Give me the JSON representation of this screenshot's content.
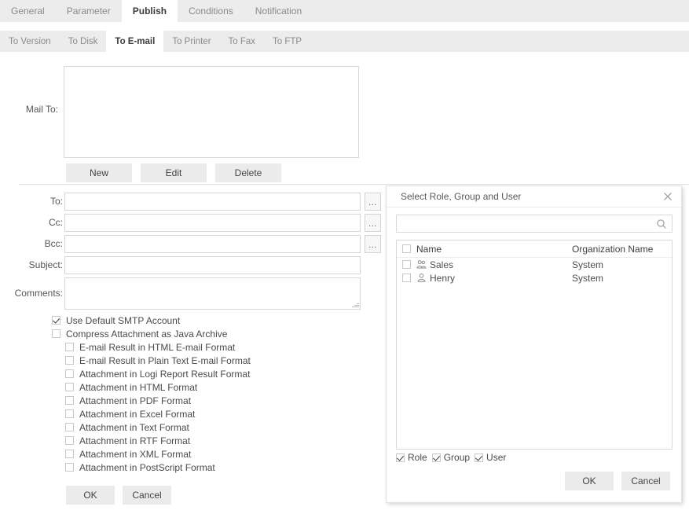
{
  "primary_tabs": [
    {
      "label": "General",
      "active": false
    },
    {
      "label": "Parameter",
      "active": false
    },
    {
      "label": "Publish",
      "active": true
    },
    {
      "label": "Conditions",
      "active": false
    },
    {
      "label": "Notification",
      "active": false
    }
  ],
  "secondary_tabs": [
    {
      "label": "To Version",
      "active": false
    },
    {
      "label": "To Disk",
      "active": false
    },
    {
      "label": "To E-mail",
      "active": true
    },
    {
      "label": "To Printer",
      "active": false
    },
    {
      "label": "To Fax",
      "active": false
    },
    {
      "label": "To FTP",
      "active": false
    }
  ],
  "mail_to": {
    "label": "Mail To:",
    "value": "",
    "buttons": {
      "new": "New",
      "edit": "Edit",
      "delete": "Delete"
    }
  },
  "form": {
    "fields": [
      {
        "label": "To:",
        "value": "",
        "has_picker": true,
        "tall": false
      },
      {
        "label": "Cc:",
        "value": "",
        "has_picker": true,
        "tall": false
      },
      {
        "label": "Bcc:",
        "value": "",
        "has_picker": true,
        "tall": false
      },
      {
        "label": "Subject:",
        "value": "",
        "has_picker": false,
        "tall": false
      },
      {
        "label": "Comments:",
        "value": "",
        "has_picker": false,
        "tall": true
      }
    ],
    "picker_label": "...",
    "checkboxes": [
      {
        "label": "Use Default SMTP Account",
        "checked": true,
        "indent": false
      },
      {
        "label": "Compress Attachment as Java Archive",
        "checked": false,
        "indent": false
      },
      {
        "label": "E-mail Result in HTML E-mail Format",
        "checked": false,
        "indent": true
      },
      {
        "label": "E-mail Result in Plain Text E-mail Format",
        "checked": false,
        "indent": true
      },
      {
        "label": "Attachment in Logi Report Result Format",
        "checked": false,
        "indent": true
      },
      {
        "label": "Attachment in HTML Format",
        "checked": false,
        "indent": true
      },
      {
        "label": "Attachment in PDF Format",
        "checked": false,
        "indent": true
      },
      {
        "label": "Attachment in Excel Format",
        "checked": false,
        "indent": true
      },
      {
        "label": "Attachment in Text Format",
        "checked": false,
        "indent": true
      },
      {
        "label": "Attachment in RTF Format",
        "checked": false,
        "indent": true
      },
      {
        "label": "Attachment in XML Format",
        "checked": false,
        "indent": true
      },
      {
        "label": "Attachment in PostScript Format",
        "checked": false,
        "indent": true
      }
    ],
    "ok_label": "OK",
    "cancel_label": "Cancel"
  },
  "dialog": {
    "title": "Select Role, Group and User",
    "close_icon": "close-icon",
    "search": {
      "value": "",
      "placeholder": "",
      "icon": "search-icon"
    },
    "table": {
      "select_all_checked": false,
      "columns": [
        "Name",
        "Organization Name"
      ],
      "rows": [
        {
          "name": "Sales",
          "org": "System",
          "checked": false,
          "icon": "group-icon"
        },
        {
          "name": "Henry",
          "org": "System",
          "checked": false,
          "icon": "user-icon"
        }
      ]
    },
    "filters": [
      {
        "label": "Role",
        "checked": true
      },
      {
        "label": "Group",
        "checked": true
      },
      {
        "label": "User",
        "checked": true
      }
    ],
    "ok_label": "OK",
    "cancel_label": "Cancel"
  },
  "colors": {
    "tabbar_bg": "#ececec",
    "active_tab_bg": "#ffffff",
    "button_bg": "#ebebeb",
    "border": "#d9d9d9",
    "text": "#444444",
    "muted_text": "#8a8a8a"
  }
}
